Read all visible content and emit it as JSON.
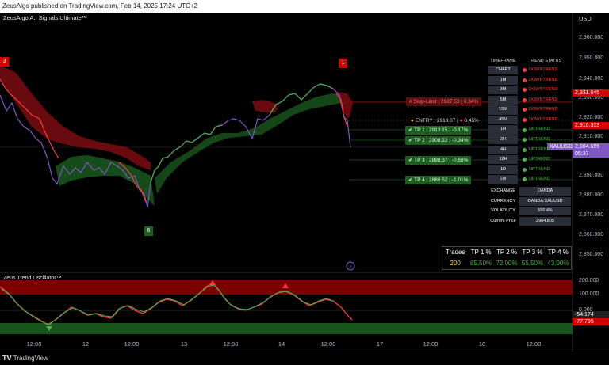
{
  "header": {
    "published": "ZeusAlgo published on TradingView.com, Feb 14, 2025 17:24 UTC+2"
  },
  "chart": {
    "title": "ZeusAlgo A.I Signals Ultimate™",
    "currency_label": "USD",
    "price_axis": [
      "2,960.000",
      "2,950.000",
      "2,940.000",
      "2,930.000",
      "2,920.000",
      "2,910.000",
      "2,900.000",
      "2,890.000",
      "2,880.000",
      "2,870.000",
      "2,860.000",
      "2,850.000"
    ],
    "price_tags": {
      "red_top": "2,931.945",
      "red_mid": "2,916.353",
      "symbol": "XAUUSD",
      "last_price": "2,904.655",
      "countdown": "05:37"
    },
    "time_axis": [
      "12:00",
      "12",
      "12:00",
      "13",
      "12:00",
      "14",
      "12:00",
      "17",
      "12:00",
      "18",
      "12:00"
    ],
    "signal_markers": {
      "sell_left": "3",
      "sell_top": "1",
      "buy_bottom": "6"
    }
  },
  "trade_levels": {
    "stop_limit": "# Stop-Limit | 2927.53 | 0.34%",
    "entry": "ENTRY | 2918.07 |",
    "entry_pct": "0.45%",
    "tp1": "✔ TP 1 | 2913.15 | -0.17%",
    "tp2": "✔ TP 2 | 2908.22 | -0.34%",
    "tp3": "✔ TP 3 | 2898.37 | -0.68%",
    "tp4": "✔ TP 4 | 2888.52 | -1.01%"
  },
  "trend_table": {
    "headers": [
      "TIMEFRAME",
      "TREND STATUS"
    ],
    "rows": [
      {
        "tf": "CHART",
        "status": "DOWNTREND",
        "color": "#ff3b3b"
      },
      {
        "tf": "1M",
        "status": "DOWNTREND",
        "color": "#ff3b3b"
      },
      {
        "tf": "3M",
        "status": "DOWNTREND",
        "color": "#ff3b3b"
      },
      {
        "tf": "5M",
        "status": "DOWNTREND",
        "color": "#ff3b3b"
      },
      {
        "tf": "15M",
        "status": "DOWNTREND",
        "color": "#ff3b3b"
      },
      {
        "tf": "45M",
        "status": "DOWNTREND",
        "color": "#ff3b3b"
      },
      {
        "tf": "1H",
        "status": "UPTREND",
        "color": "#4caf50"
      },
      {
        "tf": "2H",
        "status": "UPTREND",
        "color": "#4caf50"
      },
      {
        "tf": "4H",
        "status": "UPTREND",
        "color": "#4caf50"
      },
      {
        "tf": "12H",
        "status": "UPTREND",
        "color": "#4caf50"
      },
      {
        "tf": "1D",
        "status": "UPTREND",
        "color": "#4caf50"
      },
      {
        "tf": "1W",
        "status": "UPTREND",
        "color": "#4caf50"
      }
    ]
  },
  "info_table": {
    "rows": [
      {
        "label": "EXCHANGE",
        "value": "OANDA"
      },
      {
        "label": "CURRENCY",
        "value": "OANDA:XAUUSD"
      },
      {
        "label": "VOLATILITY",
        "value": "556.4%"
      },
      {
        "label": "Current Price",
        "value": "2904.805"
      }
    ]
  },
  "stats": {
    "headers": [
      "Trades",
      "TP 1 %",
      "TP 2 %",
      "TP 3 %",
      "TP 4 %"
    ],
    "values": [
      "200",
      "85,50%",
      "72,00%",
      "55,50%",
      "43,00%"
    ]
  },
  "oscillator": {
    "title": "Zeus Trend Oscillator™",
    "axis": [
      "200.000",
      "100.000",
      "0.000",
      "-100.000"
    ],
    "tags": {
      "value1": "-54.174",
      "value2": "-77.795"
    }
  },
  "footer": {
    "brand": "TradingView"
  },
  "colors": {
    "up": "#4caf50",
    "down": "#ff3b3b",
    "bg": "#000000",
    "accent": "#7e57c2"
  }
}
